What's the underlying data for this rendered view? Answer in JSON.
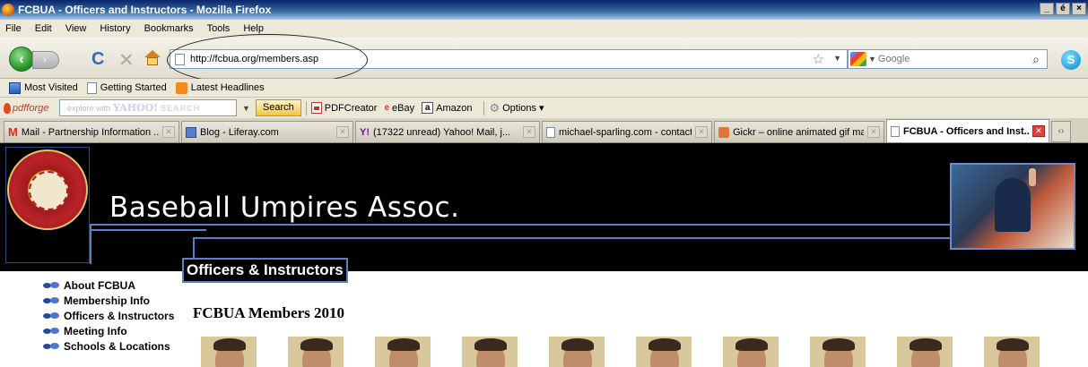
{
  "window": {
    "title": "FCBUA - Officers and Instructors - Mozilla Firefox",
    "controls": [
      "_",
      "é",
      "×"
    ]
  },
  "menu": [
    "File",
    "Edit",
    "View",
    "History",
    "Bookmarks",
    "Tools",
    "Help"
  ],
  "nav": {
    "url": "http://fcbua.org/members.asp",
    "search_engine": "Google",
    "search_placeholder": "Google"
  },
  "bookmarks": [
    {
      "label": "Most Visited",
      "icon": "most-visited-icon"
    },
    {
      "label": "Getting Started",
      "icon": "page-icon"
    },
    {
      "label": "Latest Headlines",
      "icon": "rss-icon"
    }
  ],
  "forge_toolbar": {
    "logo": "pdfforge",
    "yahoo_prefix": "explore with",
    "yahoo_brand": "YAHOO!",
    "yahoo_search": "SEARCH",
    "search_button": "Search",
    "items": [
      {
        "label": "PDFCreator",
        "icon": "pdf-icon"
      },
      {
        "label": "eBay",
        "icon": "ebay-icon"
      },
      {
        "label": "Amazon",
        "icon": "amazon-icon"
      },
      {
        "label": "Options",
        "icon": "gear-icon"
      }
    ]
  },
  "tabs": [
    {
      "label": "Mail - Partnership Information ...",
      "icon": "gmail-icon",
      "active": false
    },
    {
      "label": "Blog - Liferay.com",
      "icon": "blog-icon",
      "active": false
    },
    {
      "label": "(17322 unread) Yahoo! Mail, j...",
      "icon": "yahoo-icon",
      "active": false
    },
    {
      "label": "michael-sparling.com - contact...",
      "icon": "page-icon",
      "active": false
    },
    {
      "label": "Gickr – online animated gif ma...",
      "icon": "gickr-icon",
      "active": false
    },
    {
      "label": "FCBUA - Officers and Inst...",
      "icon": "page-icon",
      "active": true
    }
  ],
  "site": {
    "banner_title": "Baseball Umpires Assoc.",
    "section_title": "Officers & Instructors",
    "nav_items": [
      "About FCBUA",
      "Membership Info",
      "Officers & Instructors",
      "Meeting Info",
      "Schools & Locations"
    ],
    "members_heading": "FCBUA Members 2010",
    "headshot_count": 10
  },
  "colors": {
    "banner_bg": "#000000",
    "frame_line": "#5b7fc2",
    "active_tab_close": "#d9453a"
  }
}
